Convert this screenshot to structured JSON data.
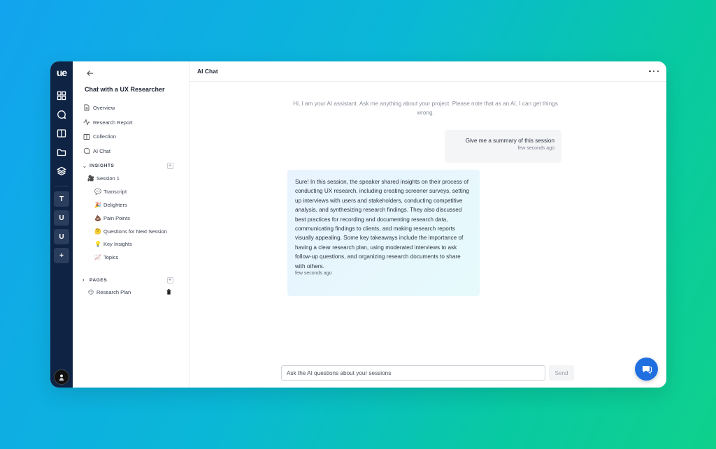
{
  "rail": {
    "logo": "ue",
    "workspaces": [
      "T",
      "U",
      "U",
      "+"
    ]
  },
  "sidebar": {
    "title": "Chat with a UX Researcher",
    "nav": [
      {
        "label": "Overview",
        "icon": "document-icon"
      },
      {
        "label": "Research Report",
        "icon": "activity-icon"
      },
      {
        "label": "Collection",
        "icon": "columns-icon"
      },
      {
        "label": "AI Chat",
        "icon": "chat-icon"
      }
    ],
    "insights": {
      "label": "INSIGHTS",
      "session": {
        "emoji": "🎥",
        "label": "Session 1"
      },
      "items": [
        {
          "emoji": "💬",
          "label": "Transcript"
        },
        {
          "emoji": "🎉",
          "label": "Delighters"
        },
        {
          "emoji": "💩",
          "label": "Pain Points"
        },
        {
          "emoji": "🤔",
          "label": "Questions for Next Session"
        },
        {
          "emoji": "💡",
          "label": "Key Insights"
        },
        {
          "emoji": "📈",
          "label": "Topics"
        }
      ]
    },
    "pages": {
      "label": "PAGES",
      "items": [
        {
          "emoji": "😏",
          "label": "Research Plan"
        }
      ]
    }
  },
  "main": {
    "title": "AI Chat",
    "intro": "Hi, I am your AI assistant. Ask me anything about your project. Please note that as an AI, I can get things wrong.",
    "user_message": {
      "text": "Give me a summary of this session",
      "time": "few seconds ago"
    },
    "ai_message": {
      "text": "Sure! In this session, the speaker shared insights on their process of conducting UX research, including creating screener surveys, setting up interviews with users and stakeholders, conducting competitive analysis, and synthesizing research findings. They also discussed best practices for recording and documenting research data, communicating findings to clients, and making research reports visually appealing. Some key takeaways include the importance of having a clear research plan, using moderated interviews to ask follow-up questions, and organizing research documents to share with others.",
      "time": "few seconds ago"
    },
    "composer": {
      "placeholder": "Ask the AI questions about your sessions",
      "send_label": "Send"
    }
  }
}
